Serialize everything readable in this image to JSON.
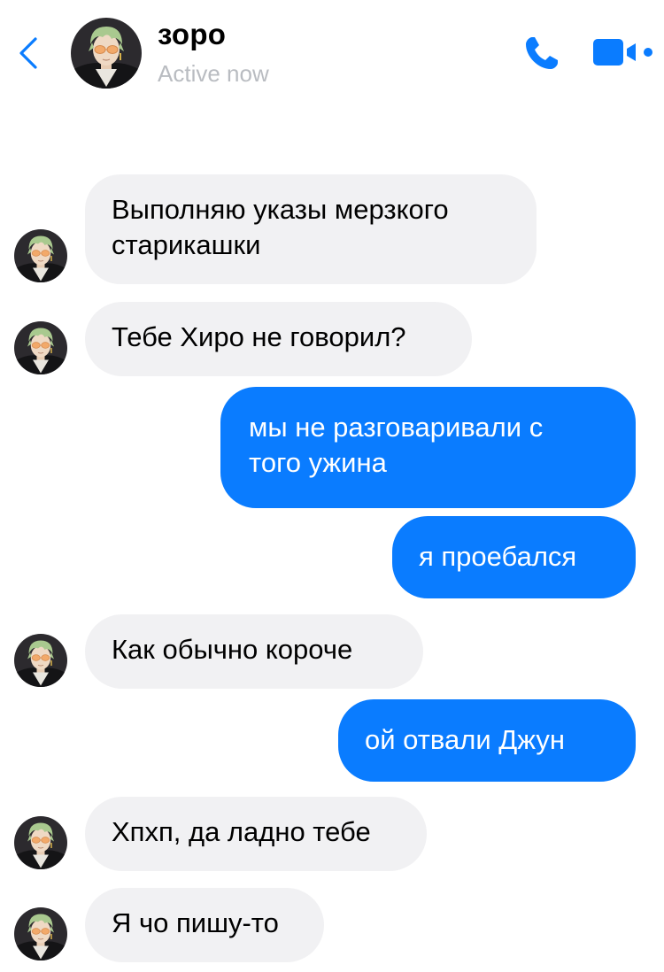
{
  "header": {
    "name": "зоро",
    "status": "Active now",
    "icons": {
      "back": "chevron-left-icon",
      "call": "phone-icon",
      "video": "video-camera-icon"
    },
    "accent_color": "#0a7cff"
  },
  "messages": [
    {
      "direction": "in",
      "text": "Выполняю указы мерзкого\nстарикашки",
      "avatar": true
    },
    {
      "direction": "in",
      "text": "Тебе Хиро не говорил?",
      "avatar": true
    },
    {
      "direction": "out",
      "text": "мы не разговаривали с\nтого ужина"
    },
    {
      "direction": "out",
      "text": "я проебался"
    },
    {
      "direction": "in",
      "text": "Как обычно короче",
      "avatar": true
    },
    {
      "direction": "out",
      "text": "ой отвали Джун"
    },
    {
      "direction": "in",
      "text": "Хпхп, да ладно тебе",
      "avatar": true
    },
    {
      "direction": "in",
      "text": "Я чо пишу-то",
      "avatar": true
    }
  ],
  "colors": {
    "incoming_bubble": "#f1f1f3",
    "outgoing_bubble": "#0a7cff",
    "status_text": "#b9bcc1"
  }
}
